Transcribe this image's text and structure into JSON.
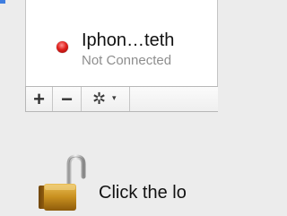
{
  "network_list": {
    "items": [
      {
        "name": "Iphon…teth",
        "status": "Not Connected",
        "status_color": "#e0201c"
      }
    ]
  },
  "toolbar": {
    "add_label": "+",
    "remove_label": "−",
    "action_icon": "gear-icon",
    "action_caret": "▾"
  },
  "lock": {
    "icon": "lock-open-icon",
    "label": "Click the lo"
  },
  "colors": {
    "background": "#ececec",
    "list_background": "#ffffff",
    "accent": "#3f7ee0"
  }
}
